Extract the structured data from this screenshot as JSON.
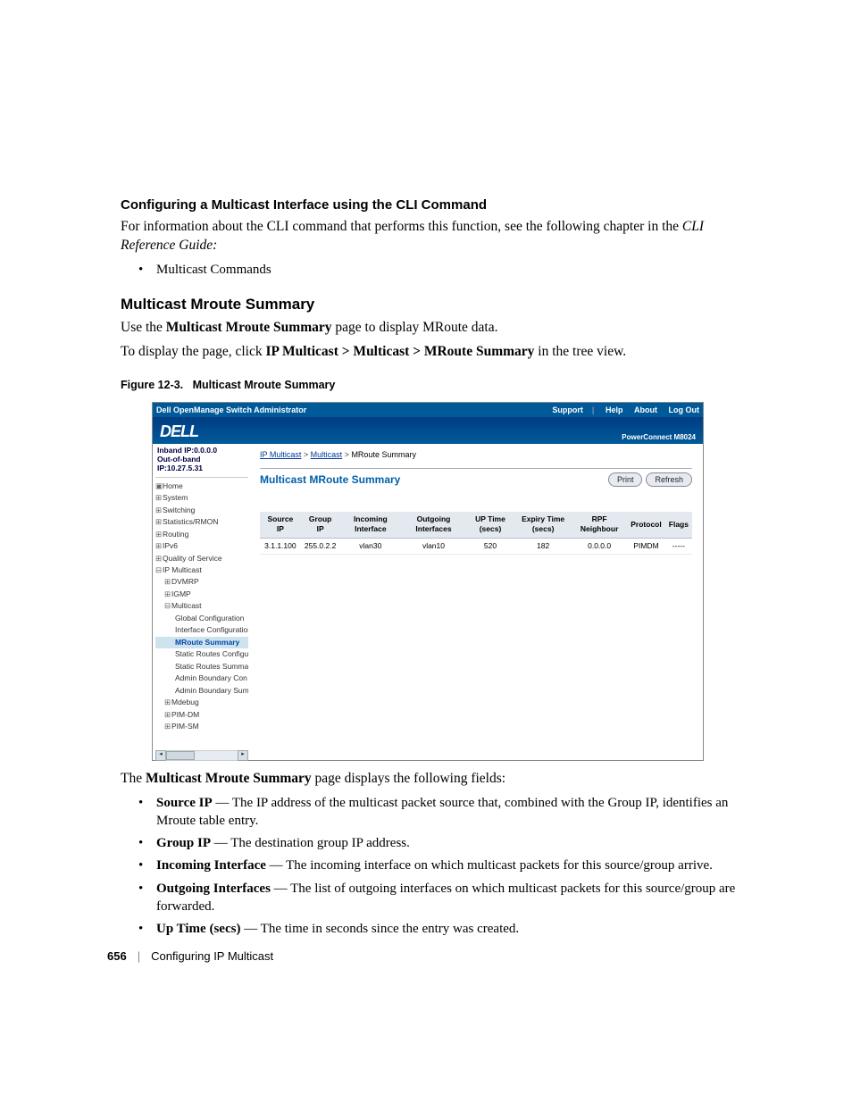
{
  "section1": {
    "heading": "Configuring a Multicast Interface using the CLI Command",
    "para_a": "For information about the CLI command that performs this function, see the following chapter in the ",
    "para_b_italic": "CLI Reference Guide:",
    "bullet1": "Multicast Commands"
  },
  "section2": {
    "heading": "Multicast Mroute Summary",
    "para1_a": "Use the ",
    "para1_b_strong": "Multicast Mroute Summary",
    "para1_c": " page to display MRoute data.",
    "para2_a": "To display the page, click ",
    "para2_b_strong": "IP Multicast > Multicast > MRoute Summary",
    "para2_c": " in the tree view."
  },
  "figure": {
    "caption_label": "Figure 12-3.",
    "caption_title": "Multicast Mroute Summary"
  },
  "shot": {
    "topbar": {
      "title": "Dell OpenManage Switch Administrator",
      "links": {
        "support": "Support",
        "help": "Help",
        "about": "About",
        "logout": "Log Out"
      }
    },
    "logo_text": "DELL",
    "model": "PowerConnect M8024",
    "ip": {
      "inband": "Inband IP:0.0.0.0",
      "oob": "Out-of-band IP:10.27.5.31"
    },
    "tree": {
      "home": "Home",
      "system": "System",
      "switching": "Switching",
      "stats": "Statistics/RMON",
      "routing": "Routing",
      "ipv6": "IPv6",
      "qos": "Quality of Service",
      "ipmc": "IP Multicast",
      "dvmrp": "DVMRP",
      "igmp": "IGMP",
      "multicast": "Multicast",
      "global": "Global Configuration",
      "ifcfg": "Interface Configuration",
      "mroute": "MRoute Summary",
      "sroutec": "Static Routes Configu",
      "sroutes": "Static Routes Summa",
      "adminbc": "Admin Boundary Con",
      "adminbs": "Admin Boundary Sum",
      "mdebug": "Mdebug",
      "pimdm": "PIM-DM",
      "pimsm": "PIM-SM"
    },
    "crumb": {
      "a": "IP Multicast",
      "b": "Multicast",
      "c": "MRoute Summary"
    },
    "panel_title": "Multicast MRoute Summary",
    "btn_print": "Print",
    "btn_refresh": "Refresh",
    "table": {
      "headers": {
        "src": "Source IP",
        "grp": "Group IP",
        "inif": "Incoming Interface",
        "outif": "Outgoing Interfaces",
        "up": "UP Time (secs)",
        "exp": "Expiry Time (secs)",
        "rpf": "RPF Neighbour",
        "proto": "Protocol",
        "flags": "Flags"
      },
      "row": {
        "src": "3.1.1.100",
        "grp": "255.0.2.2",
        "inif": "vlan30",
        "outif": "vlan10",
        "up": "520",
        "exp": "182",
        "rpf": "0.0.0.0",
        "proto": "PIMDM",
        "flags": "-----"
      }
    }
  },
  "after": {
    "intro_a": "The ",
    "intro_b_strong": "Multicast Mroute Summary",
    "intro_c": " page displays the following fields:",
    "b1_s": "Source IP",
    "b1_t": " — The IP address of the multicast packet source that, combined with the Group IP, identifies an Mroute table entry.",
    "b2_s": "Group IP",
    "b2_t": " — The destination group IP address.",
    "b3_s": "Incoming Interface",
    "b3_t": " — The incoming interface on which multicast packets for this source/group arrive.",
    "b4_s": "Outgoing Interfaces",
    "b4_t": " — The list of outgoing interfaces on which multicast packets for this source/group are forwarded.",
    "b5_s": "Up Time (secs)",
    "b5_t": " — The time in seconds since the entry was created."
  },
  "footer": {
    "page": "656",
    "chapter": "Configuring IP Multicast"
  }
}
